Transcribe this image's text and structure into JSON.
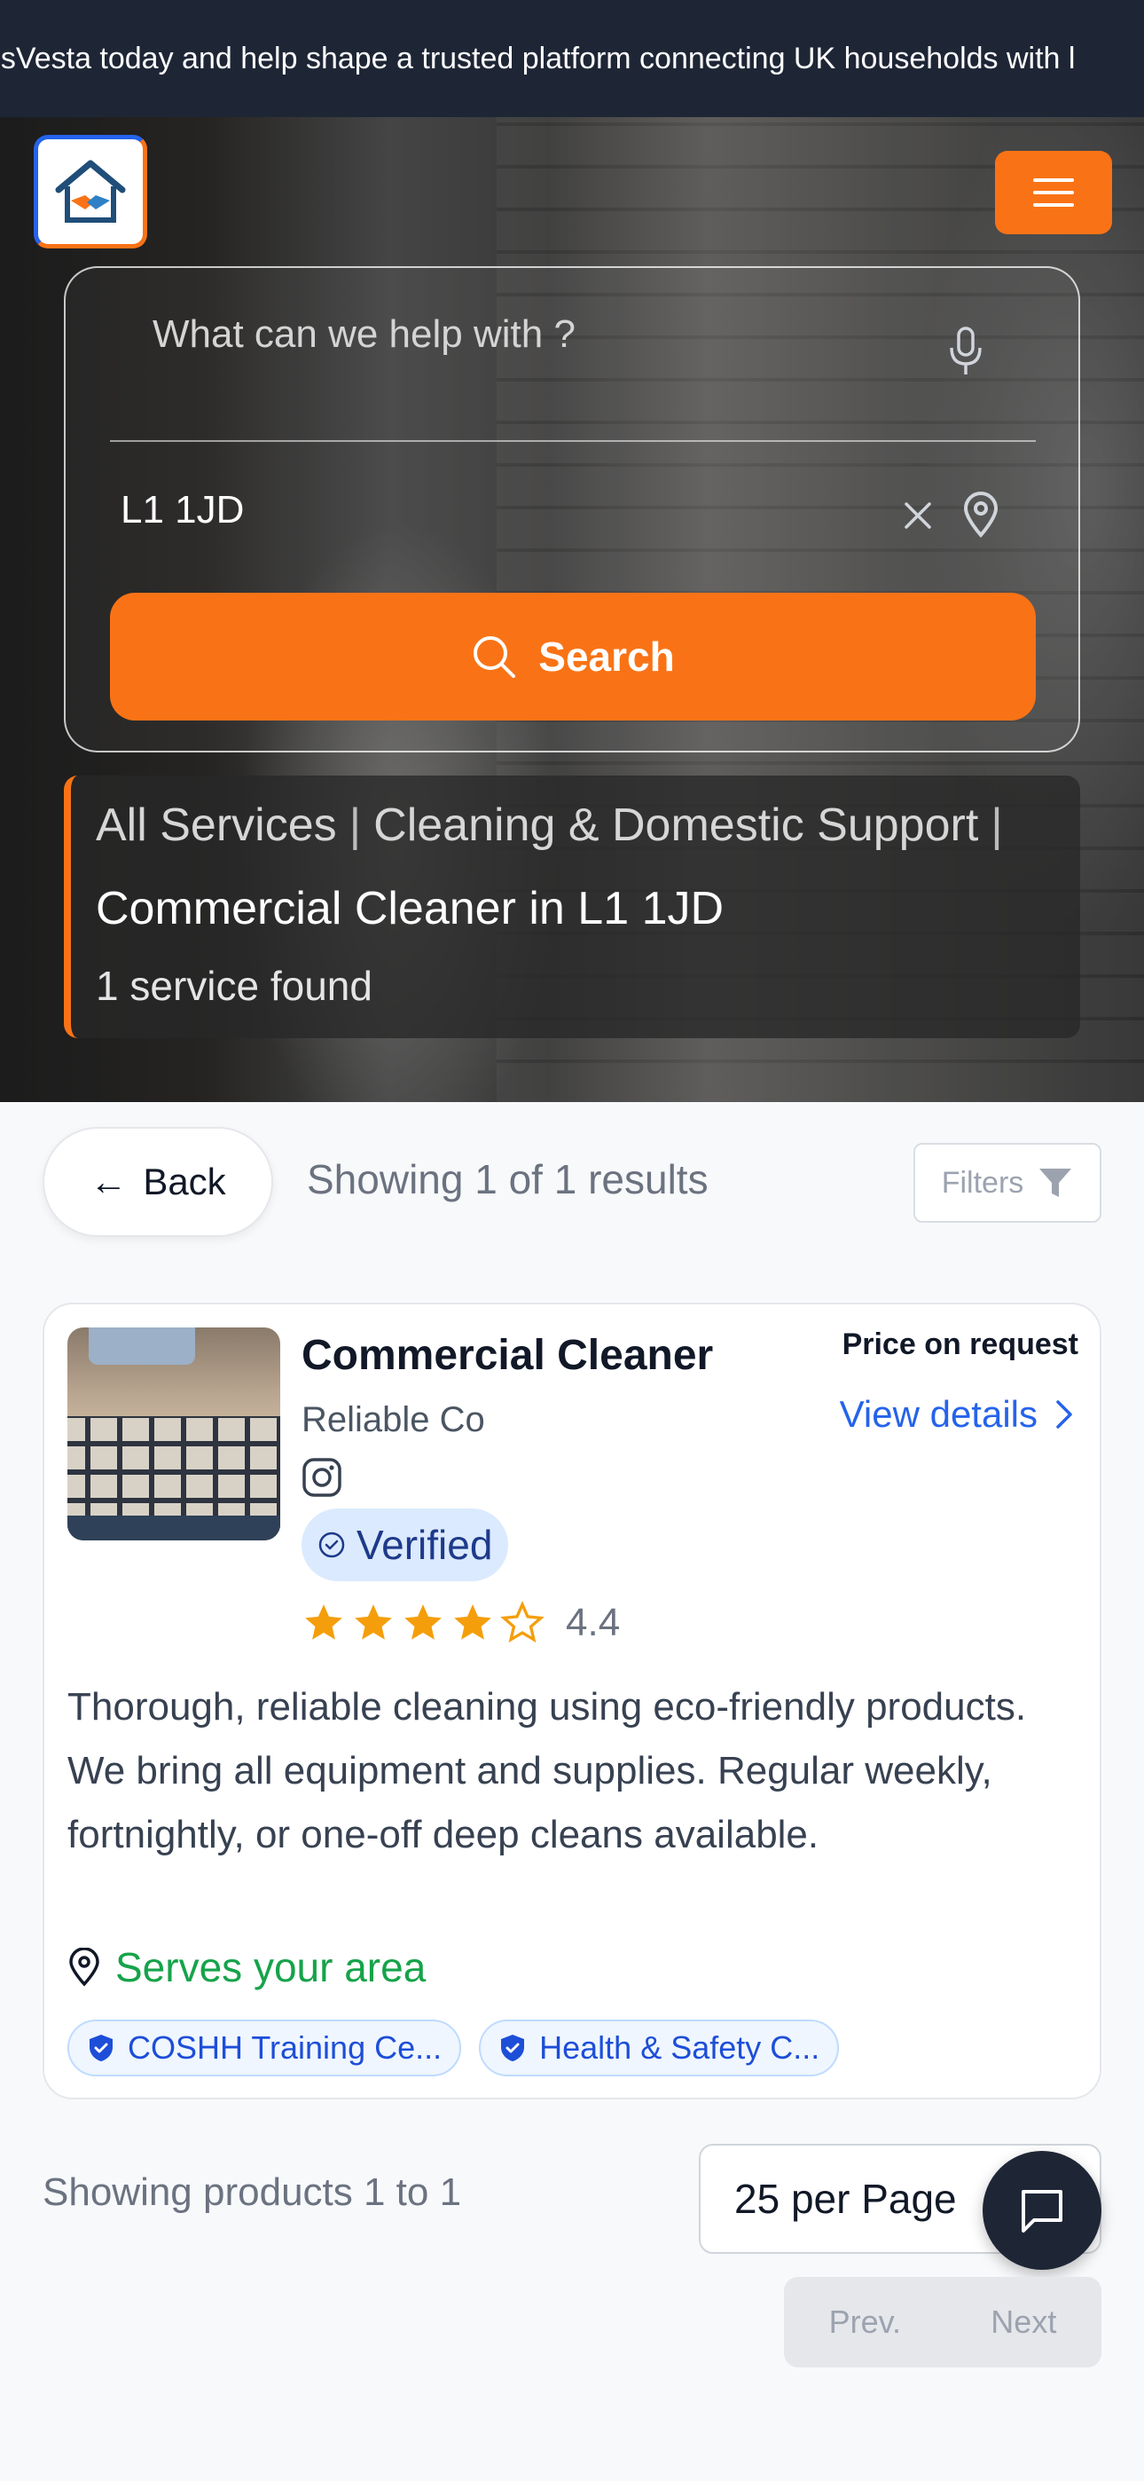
{
  "ticker": {
    "text": "usVesta today and help shape a trusted platform connecting UK households with l"
  },
  "header": {
    "logo_icon": "house-handshake-icon",
    "menu_icon": "hamburger-icon"
  },
  "search": {
    "query_placeholder": "What can we help with ?",
    "query_value": "",
    "location_value": "L1 1JD",
    "button_label": "Search",
    "mic_icon": "microphone-icon",
    "clear_icon": "close-icon",
    "pin_icon": "map-pin-icon"
  },
  "breadcrumb": {
    "all_services": "All Services",
    "separator": "|",
    "category": "Cleaning & Domestic Support",
    "service": "Commercial Cleaner",
    "location_suffix": "in L1 1JD",
    "count": "1 service found"
  },
  "toolbar": {
    "back_label": "Back",
    "back_arrow": "←",
    "showing": "Showing 1 of 1 results",
    "filters_label": "Filters"
  },
  "listing": {
    "title": "Commercial Cleaner",
    "company": "Reliable Co",
    "verified_label": "Verified",
    "rating": "4.4",
    "rating_value": 4.4,
    "price": "Price on request",
    "view_details": "View details",
    "description": "Thorough, reliable cleaning using eco-friendly products. We bring all equipment and supplies. Regular weekly, fortnightly, or one-off deep cleans available.",
    "serves": "Serves your area",
    "badges": [
      "COSHH Training Ce...",
      "Health & Safety C..."
    ]
  },
  "pagination": {
    "showing": "Showing products 1 to 1",
    "per_page": "25 per Page",
    "prev": "Prev.",
    "next": "Next"
  },
  "colors": {
    "accent": "#f97316",
    "primary": "#2563eb",
    "dark": "#1e2636",
    "success": "#16a34a"
  }
}
